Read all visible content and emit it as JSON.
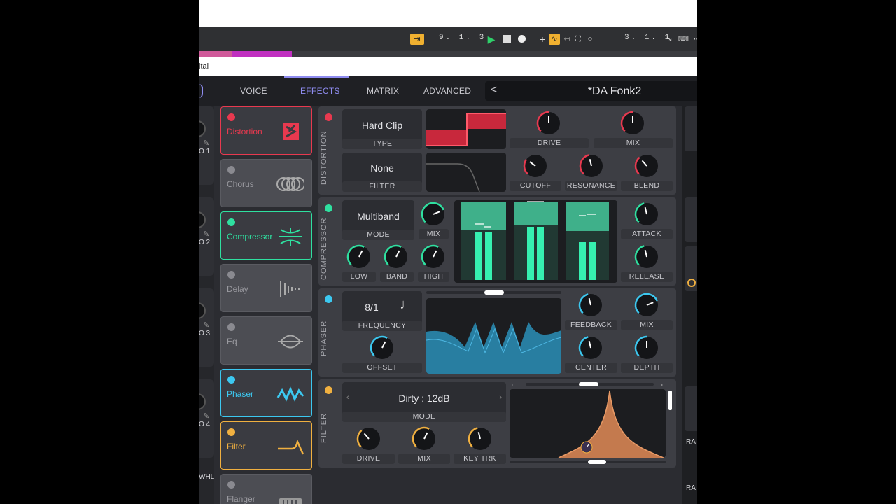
{
  "transport": {
    "position": "9. 1. 3",
    "loop_position": "3. 1. 1"
  },
  "titlebar": {
    "text": "ital"
  },
  "nav": {
    "tabs": [
      {
        "label": "VOICE"
      },
      {
        "label": "EFFECTS",
        "active": true
      },
      {
        "label": "MATRIX"
      },
      {
        "label": "ADVANCED"
      }
    ],
    "preset_name": "*DA Fonk2",
    "prev_chevron": "<"
  },
  "left_mod": {
    "lfo_labels": [
      "O 1",
      "O 2",
      "O 3",
      "O 4"
    ],
    "whl_label": "WHL"
  },
  "effects_list": [
    {
      "label": "Distortion",
      "enabled": true,
      "color": "#e8394f",
      "icon": "distortion-icon"
    },
    {
      "label": "Chorus",
      "enabled": false,
      "color": "#8a8a90",
      "icon": "chorus-icon"
    },
    {
      "label": "Compressor",
      "enabled": true,
      "color": "#2fe0a0",
      "icon": "compressor-icon"
    },
    {
      "label": "Delay",
      "enabled": false,
      "color": "#8a8a90",
      "icon": "delay-icon"
    },
    {
      "label": "Eq",
      "enabled": false,
      "color": "#8a8a90",
      "icon": "eq-icon"
    },
    {
      "label": "Phaser",
      "enabled": true,
      "color": "#3cc8f0",
      "icon": "phaser-icon"
    },
    {
      "label": "Filter",
      "enabled": true,
      "color": "#f0b040",
      "icon": "filter-icon"
    },
    {
      "label": "Flanger",
      "enabled": false,
      "color": "#8a8a90",
      "icon": "flanger-icon"
    }
  ],
  "distortion": {
    "title": "DISTORTION",
    "color": "#e8394f",
    "type_value": "Hard Clip",
    "type_label": "TYPE",
    "filter_value": "None",
    "filter_label": "FILTER",
    "knobs": [
      {
        "label": "DRIVE",
        "value": 0.5
      },
      {
        "label": "MIX",
        "value": 0.5
      },
      {
        "label": "CUTOFF",
        "value": 0.3
      },
      {
        "label": "RESONANCE",
        "value": 0.45
      },
      {
        "label": "BLEND",
        "value": 0.35
      }
    ]
  },
  "compressor": {
    "title": "COMPRESSOR",
    "color": "#2fe0a0",
    "mode_value": "Multiband",
    "mode_label": "MODE",
    "knobs": [
      {
        "label": "MIX",
        "value": 0.75
      },
      {
        "label": "LOW",
        "value": 0.6
      },
      {
        "label": "BAND",
        "value": 0.6
      },
      {
        "label": "HIGH",
        "value": 0.6
      },
      {
        "label": "ATTACK",
        "value": 0.45
      },
      {
        "label": "RELEASE",
        "value": 0.45
      }
    ]
  },
  "phaser": {
    "title": "PHASER",
    "color": "#3cc8f0",
    "frequency_value": "8/1",
    "frequency_label": "FREQUENCY",
    "note_icon": "quarter-note-icon",
    "knobs": [
      {
        "label": "OFFSET",
        "value": 0.6
      },
      {
        "label": "FEEDBACK",
        "value": 0.45
      },
      {
        "label": "MIX",
        "value": 0.75
      },
      {
        "label": "CENTER",
        "value": 0.45
      },
      {
        "label": "DEPTH",
        "value": 0.5
      }
    ]
  },
  "filter": {
    "title": "FILTER",
    "color": "#f0b040",
    "mode_value": "Dirty : 12dB",
    "mode_label": "MODE",
    "knobs": [
      {
        "label": "DRIVE",
        "value": 0.35
      },
      {
        "label": "MIX",
        "value": 0.6
      },
      {
        "label": "KEY TRK",
        "value": 0.45
      }
    ]
  },
  "right_strip": {
    "labels": [
      "RA",
      "RA"
    ]
  }
}
